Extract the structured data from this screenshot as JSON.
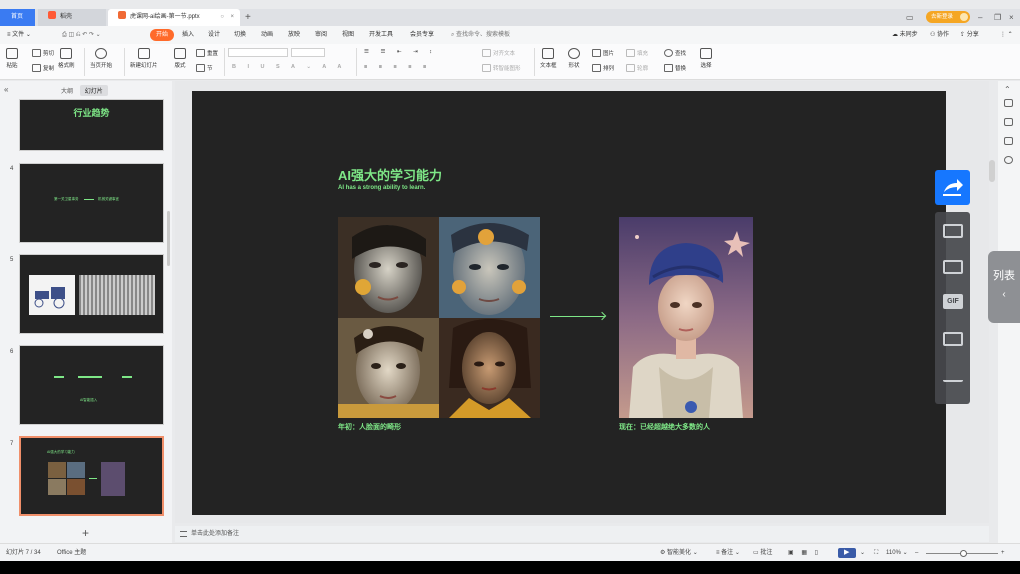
{
  "tabs": {
    "home": "首页",
    "docer": "稻壳",
    "file": "虎课网-ai绘画-第一节.pptx"
  },
  "title_bar": {
    "login": "去新登录"
  },
  "menu": {
    "file": "文件",
    "items": [
      "开始",
      "插入",
      "设计",
      "切换",
      "动画",
      "放映",
      "审阅",
      "视图",
      "开发工具",
      "会员专享"
    ],
    "search": "查找命令、搜索模板",
    "right": [
      "未同步",
      "协作",
      "分享"
    ]
  },
  "ribbon": {
    "paste": "粘贴",
    "cut": "剪切",
    "copy": "复制",
    "format_painter": "格式刷",
    "play_from_current": "当页开始",
    "new_slide": "新建幻灯片",
    "layout": "版式",
    "reset": "重置",
    "section": "节",
    "align_text": "对齐文本",
    "smart_convert": "转智能图形",
    "textbox": "文本框",
    "shape": "形状",
    "picture": "图片",
    "arrange": "排列",
    "fill": "填充",
    "outline": "轮廓",
    "find": "查找",
    "replace": "替换",
    "select": "选择"
  },
  "left_pane": {
    "tab_outline": "大纲",
    "tab_slides": "幻灯片",
    "slides": [
      {
        "num": "",
        "title": "行业趋势"
      },
      {
        "num": "4",
        "title": "第一关卫星事务",
        "right": "机械关键事宜"
      },
      {
        "num": "5",
        "title": ""
      },
      {
        "num": "6",
        "title": "AI智能插入"
      },
      {
        "num": "7",
        "title": "AI强大的学习能力"
      }
    ]
  },
  "slide": {
    "title": "AI强大的学习能力",
    "subtitle": "AI has a strong ability to learn.",
    "caption_left": "年初：人脸面的畸形",
    "caption_right": "现在：已经超越绝大多数的人"
  },
  "notes": {
    "placeholder": "单击此处添加备注"
  },
  "side_panel": {
    "list_label": "列表"
  },
  "status": {
    "slide_counter": "幻灯片 7 / 34",
    "theme": "Office 主题",
    "beautify": "智能美化",
    "notes": "备注",
    "comment": "批注",
    "zoom": "110%"
  },
  "colors": {
    "accent": "#7ee787",
    "ribbon_active": "#ff6a2a",
    "home_tab": "#3a7bf2",
    "float_blue": "#1677ff"
  }
}
